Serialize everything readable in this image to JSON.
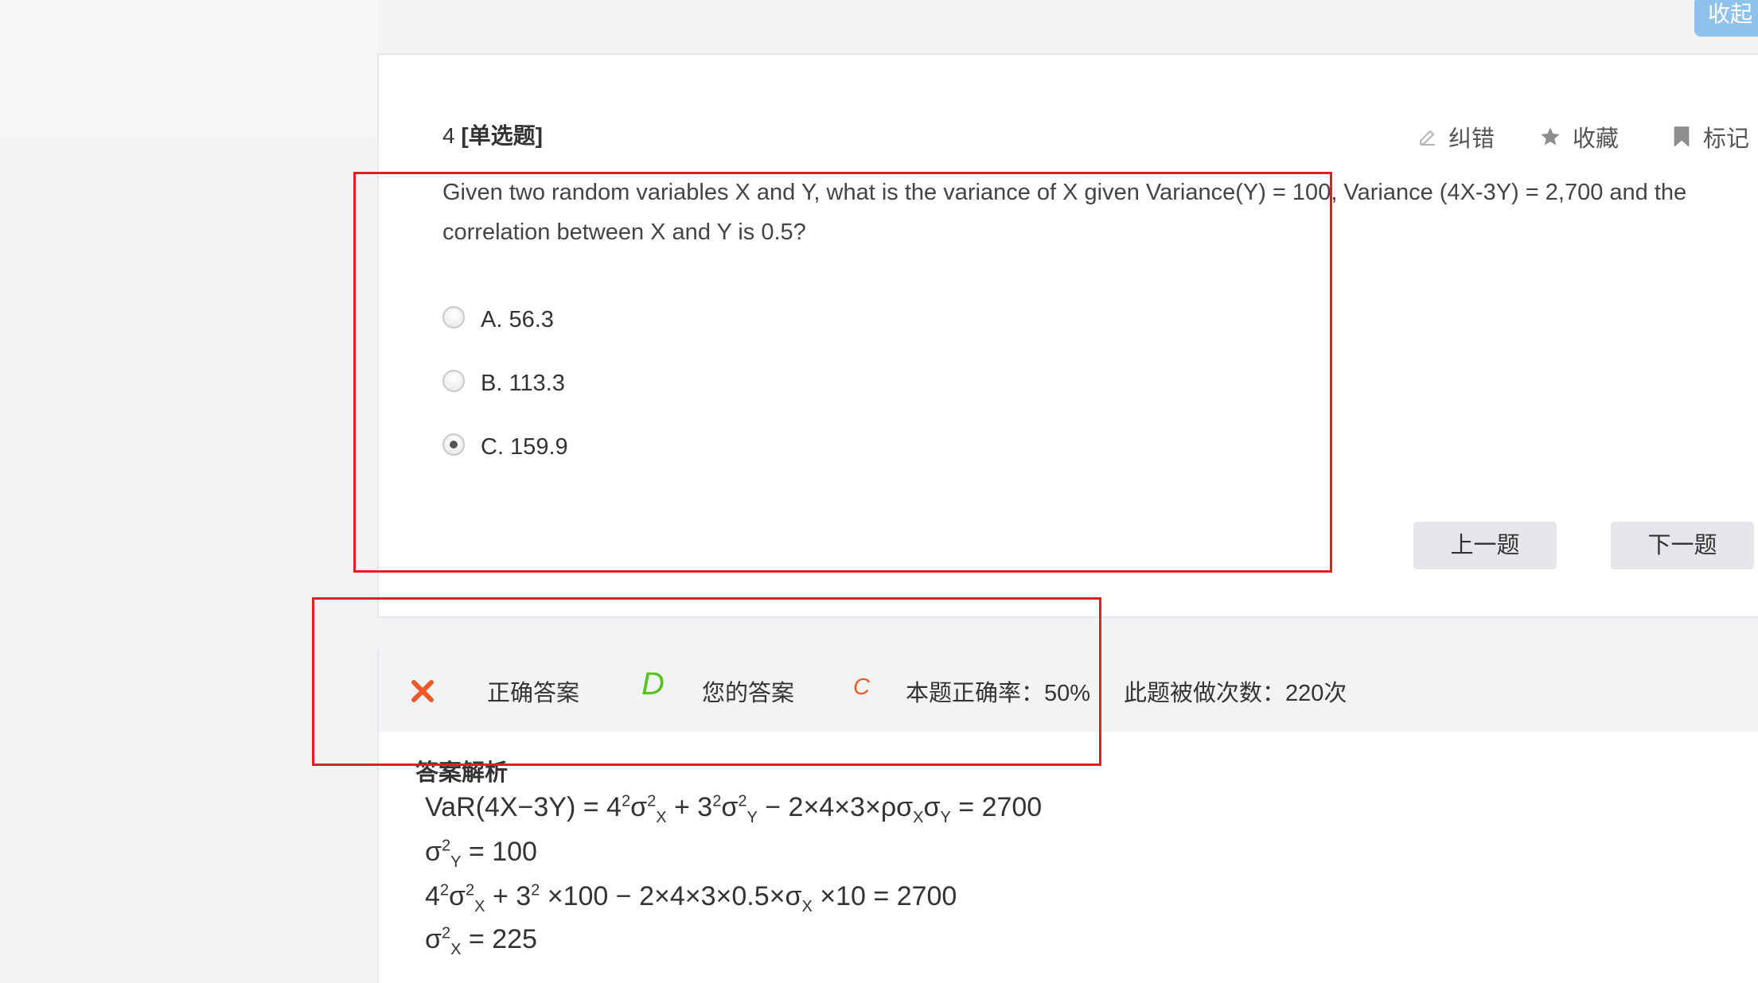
{
  "collapse_label": "收起",
  "question": {
    "number": "4",
    "type_tag": "[单选题]",
    "text": "Given two random variables X and Y, what is the variance of X given Variance(Y) = 100, Variance (4X-3Y) = 2,700 and the correlation between X and Y is 0.5?",
    "actions": {
      "report": "纠错",
      "favorite": "收藏",
      "mark": "标记"
    },
    "options": [
      {
        "label": "A. 56.3",
        "selected": false
      },
      {
        "label": "B. 113.3",
        "selected": false
      },
      {
        "label": "C. 159.9",
        "selected": true
      }
    ],
    "prev_label": "上一题",
    "next_label": "下一题"
  },
  "result": {
    "correct_answer_label": "正确答案",
    "correct_answer": "D",
    "your_answer_label": "您的答案",
    "your_answer": "C",
    "accuracy": "本题正确率：50%",
    "attempts": "此题被做次数：220次"
  },
  "analysis": {
    "title": "答案解析",
    "lines": [
      "VaR(4X−3Y) = 4²σX² + 3²σY² − 2×4×3×ρσXσY = 2700",
      "σY² = 100",
      "4²σX² + 3² ×100 − 2×4×3×0.5×σX ×10 = 2700",
      "σX² = 225"
    ]
  },
  "colors": {
    "wrong_mark": "#f05a28",
    "correct_answer": "#52c41a",
    "your_answer": "#f05a28",
    "highlight_box": "#e02020"
  }
}
